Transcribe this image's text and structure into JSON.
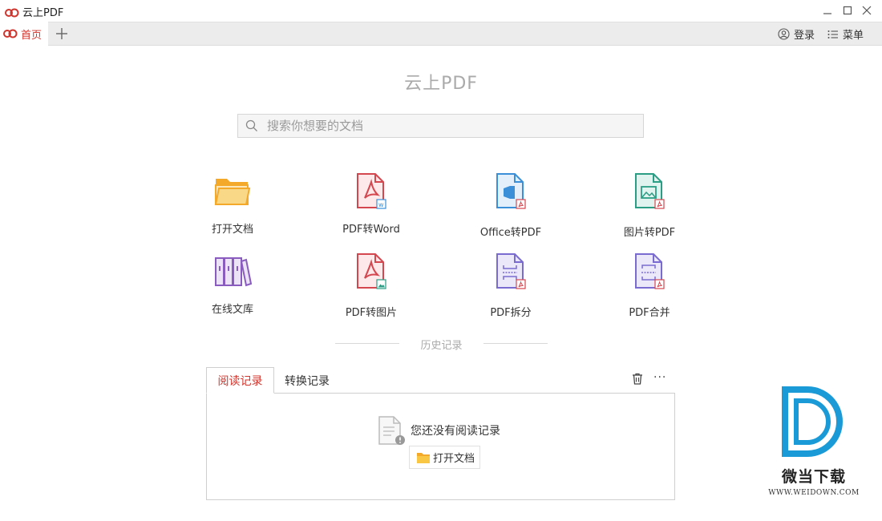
{
  "window": {
    "title": "云上PDF"
  },
  "tabs": {
    "home_label": "首页"
  },
  "header": {
    "login_label": "登录",
    "menu_label": "菜单"
  },
  "hero": {
    "title": "云上PDF"
  },
  "search": {
    "placeholder": "搜索你想要的文档"
  },
  "tools": [
    {
      "label": "打开文档",
      "icon": "folder-icon"
    },
    {
      "label": "PDF转Word",
      "icon": "pdf-to-word-icon"
    },
    {
      "label": "Office转PDF",
      "icon": "office-to-pdf-icon"
    },
    {
      "label": "图片转PDF",
      "icon": "image-to-pdf-icon"
    },
    {
      "label": "在线文库",
      "icon": "library-books-icon"
    },
    {
      "label": "PDF转图片",
      "icon": "pdf-to-image-icon"
    },
    {
      "label": "PDF拆分",
      "icon": "pdf-split-icon"
    },
    {
      "label": "PDF合并",
      "icon": "pdf-merge-icon"
    }
  ],
  "history": {
    "title": "历史记录",
    "tabs": [
      {
        "label": "阅读记录",
        "active": true
      },
      {
        "label": "转换记录",
        "active": false
      }
    ],
    "more_label": "···",
    "empty_message": "您还没有阅读记录",
    "open_button_label": "打开文档"
  },
  "watermark": {
    "name": "微当下载",
    "url": "WWW.WEIDOWN.COM"
  },
  "colors": {
    "accent": "#d0342c",
    "folder": "#f4a92a",
    "pdf_red": "#d5474f",
    "office_blue": "#3b8fd9",
    "image_teal": "#2a9d84",
    "library_purple": "#8a5cc0",
    "split_purple": "#7a6bd0",
    "watermark_blue": "#1a9bd8"
  }
}
